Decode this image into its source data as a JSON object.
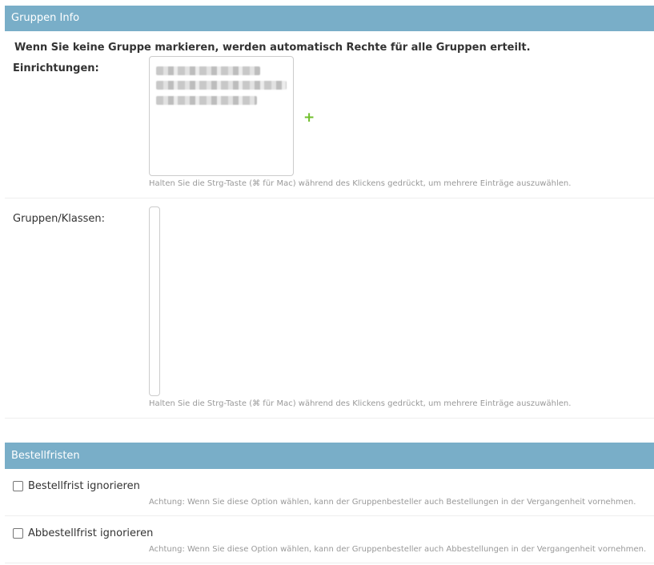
{
  "gruppen_info": {
    "title": "Gruppen Info",
    "description": "Wenn Sie keine Gruppe markieren, werden automatisch Rechte für alle Gruppen erteilt.",
    "einrichtungen": {
      "label": "Einrichtungen:",
      "add_icon": "plus-icon",
      "add_symbol": "+",
      "help": "Halten Sie die Strg-Taste (⌘ für Mac) während des Klickens gedrückt, um mehrere Einträge auszuwählen."
    },
    "gruppen_klassen": {
      "label": "Gruppen/Klassen:",
      "help": "Halten Sie die Strg-Taste (⌘ für Mac) während des Klickens gedrückt, um mehrere Einträge auszuwählen."
    }
  },
  "bestellfristen": {
    "title": "Bestellfristen",
    "bestellfrist": {
      "label": "Bestellfrist ignorieren",
      "checked": false,
      "help": "Achtung: Wenn Sie diese Option wählen, kann der Gruppenbesteller auch Bestellungen in der Vergangenheit vornehmen."
    },
    "abbestellfrist": {
      "label": "Abbestellfrist ignorieren",
      "checked": false,
      "help": "Achtung: Wenn Sie diese Option wählen, kann der Gruppenbesteller auch Abbestellungen in der Vergangenheit vornehmen."
    }
  },
  "colors": {
    "header_bg": "#79aec8",
    "add_icon": "#70bf2b",
    "help_text": "#999999"
  }
}
